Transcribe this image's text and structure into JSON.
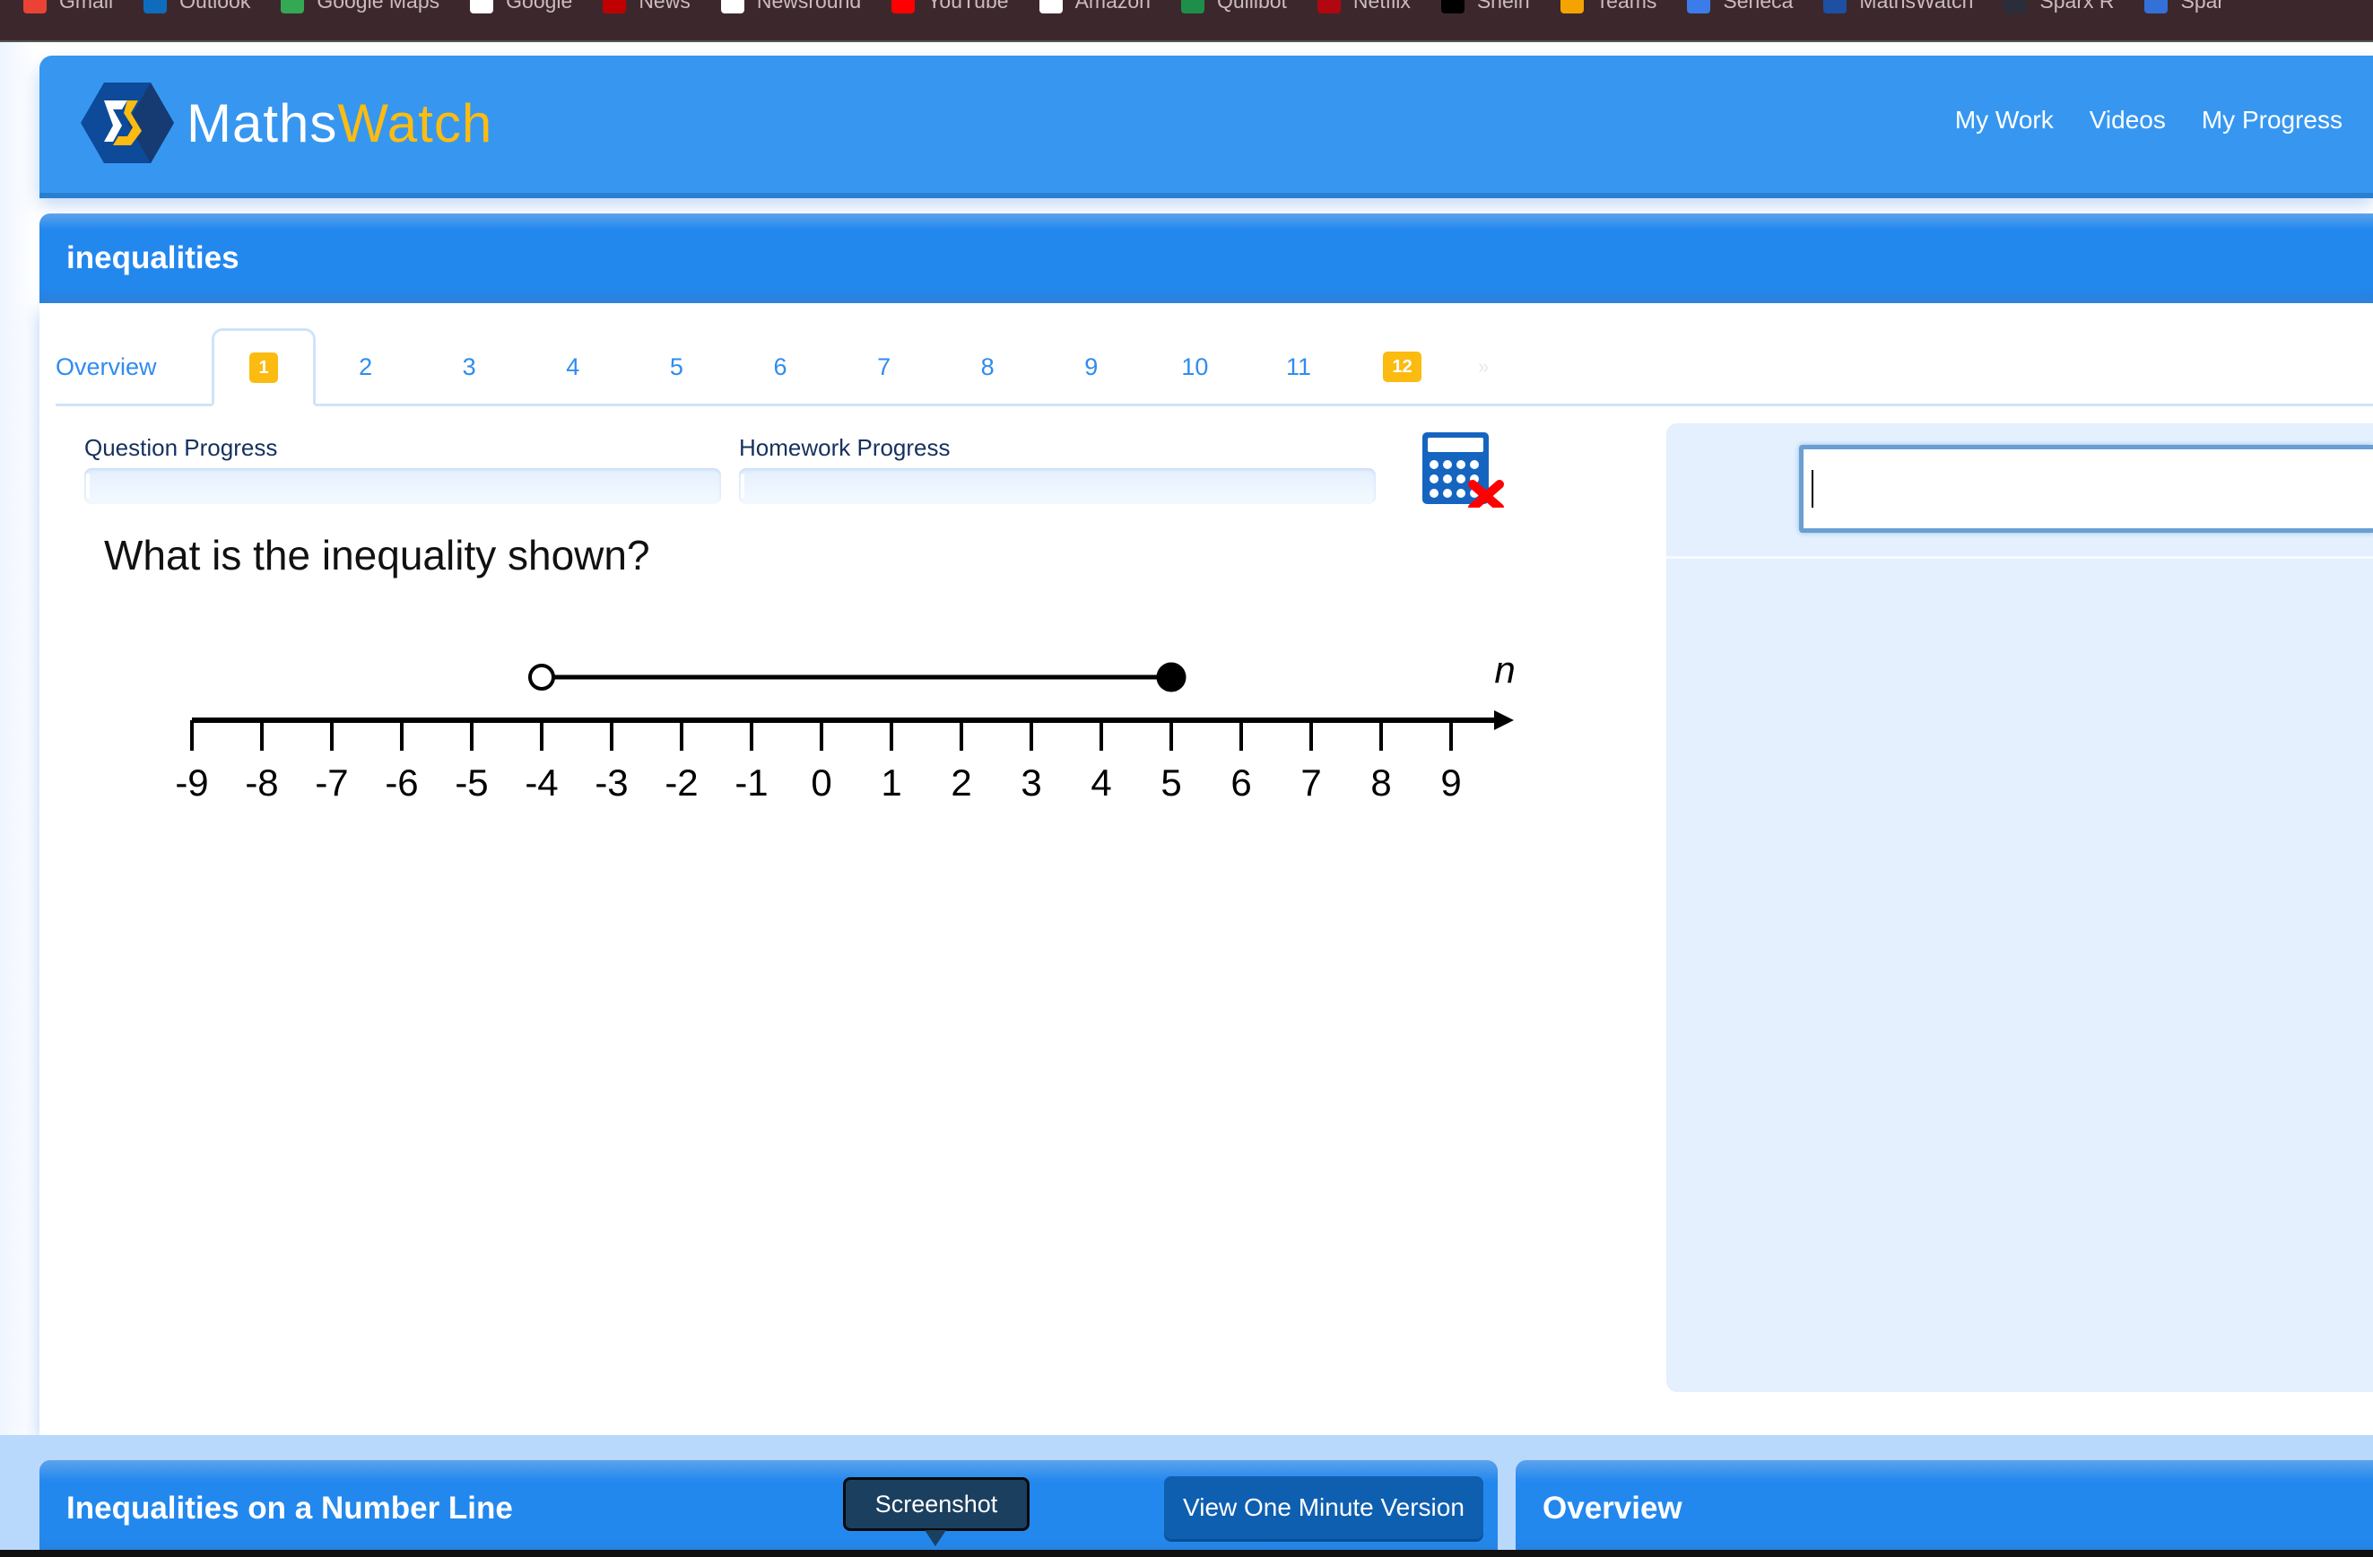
{
  "bookmarks": [
    {
      "label": "Gmail",
      "icon": "gmail-icon",
      "color": "#ea4335"
    },
    {
      "label": "Outlook",
      "icon": "outlook-icon",
      "color": "#0f6cbd"
    },
    {
      "label": "Google Maps",
      "icon": "google-maps-icon",
      "color": "#34a853"
    },
    {
      "label": "Google",
      "icon": "google-icon",
      "color": "#ffffff"
    },
    {
      "label": "News",
      "icon": "news-icon",
      "color": "#c00000"
    },
    {
      "label": "Newsround",
      "icon": "newsround-icon",
      "color": "#ffffff"
    },
    {
      "label": "YouTube",
      "icon": "youtube-icon",
      "color": "#ff0000"
    },
    {
      "label": "Amazon",
      "icon": "amazon-icon",
      "color": "#ffffff"
    },
    {
      "label": "Quillbot",
      "icon": "quillbot-icon",
      "color": "#1e8f4a"
    },
    {
      "label": "Netflix",
      "icon": "netflix-icon",
      "color": "#b00710"
    },
    {
      "label": "Shein",
      "icon": "shein-icon",
      "color": "#000000"
    },
    {
      "label": "Teams",
      "icon": "teams-icon",
      "color": "#f4a300"
    },
    {
      "label": "Seneca",
      "icon": "seneca-icon",
      "color": "#3b7bea"
    },
    {
      "label": "MathsWatch",
      "icon": "mathswatch-icon",
      "color": "#1d4fa3"
    },
    {
      "label": "Sparx R",
      "icon": "sparx-reader-icon",
      "color": "#2a2e3a"
    },
    {
      "label": "Spar",
      "icon": "sparx-icon",
      "color": "#3370d8"
    }
  ],
  "header": {
    "logo_part1": "Maths",
    "logo_part2": "Watch",
    "nav": [
      "My Work",
      "Videos",
      "My Progress"
    ]
  },
  "title": "inequalities",
  "tabs": {
    "overview": "Overview",
    "prev": "«",
    "next": "»",
    "questions": [
      "1",
      "2",
      "3",
      "4",
      "5",
      "6",
      "7",
      "8",
      "9",
      "10",
      "11",
      "12"
    ],
    "active": "1",
    "highlighted": [
      "1",
      "12"
    ]
  },
  "progress": {
    "question_label": "Question Progress",
    "question_value": 0,
    "homework_label": "Homework Progress",
    "homework_value": 0
  },
  "calculator": {
    "icon": "calculator-not-allowed-icon",
    "allowed": false
  },
  "question": {
    "text": "What is the inequality shown?",
    "number_line": {
      "variable": "n",
      "min": -9,
      "max": 9,
      "ticks": [
        "-9",
        "-8",
        "-7",
        "-6",
        "-5",
        "-4",
        "-3",
        "-2",
        "-1",
        "0",
        "1",
        "2",
        "3",
        "4",
        "5",
        "6",
        "7",
        "8",
        "9"
      ],
      "left_endpoint": {
        "value": -4,
        "closed": false
      },
      "right_endpoint": {
        "value": 5,
        "closed": true
      }
    }
  },
  "answer": {
    "value": "",
    "placeholder": ""
  },
  "bottom": {
    "video_title": "Inequalities on a Number Line",
    "tooltip": "Screenshot",
    "one_minute_button": "View One Minute Version",
    "overview_title": "Overview"
  }
}
